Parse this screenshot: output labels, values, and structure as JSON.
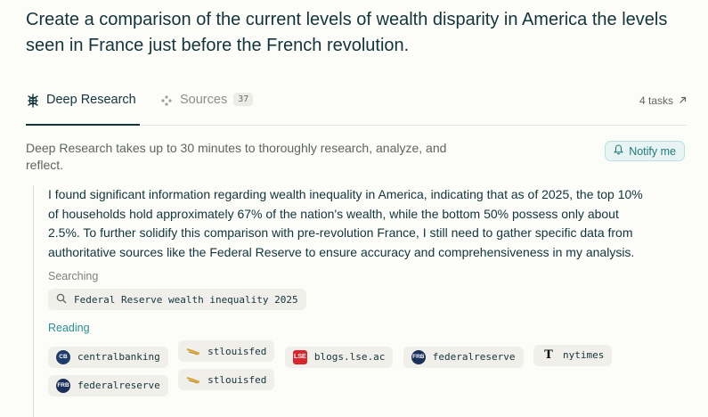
{
  "query": "Create a comparison of the current levels of wealth disparity in America the levels seen in France just before the French revolution.",
  "tabs": {
    "deep_research": "Deep Research",
    "sources": "Sources",
    "sources_count": "37",
    "tasks": "4 tasks"
  },
  "description": "Deep Research takes up to 30 minutes to thoroughly research, analyze, and reflect.",
  "notify_label": "Notify me",
  "panel": {
    "text": "I found significant information regarding wealth inequality in America, indicating that as of 2025, the top 10% of households hold approximately 67% of the nation's wealth, while the bottom 50% possess only about 2.5%. To further solidify this comparison with pre-revolution France, I still need to gather specific data from authoritative sources like the Federal Reserve to ensure accuracy and comprehensiveness in my analysis.",
    "searching_label": "Searching",
    "search_query": "Federal Reserve wealth inequality 2025",
    "reading_label": "Reading",
    "sources_row1": [
      {
        "name": "centralbanking",
        "icon": "centralbanking-icon",
        "badge": "CB"
      },
      {
        "name": "stlouisfed",
        "icon": "stlouisfed-icon",
        "badge": ""
      },
      {
        "name": "blogs.lse.ac",
        "icon": "lse-icon",
        "badge": "LSE"
      },
      {
        "name": "federalreserve",
        "icon": "federalreserve-icon",
        "badge": "FRB"
      },
      {
        "name": "nytimes",
        "icon": "nytimes-icon",
        "badge": "T"
      }
    ],
    "sources_row2": [
      {
        "name": "federalreserve",
        "icon": "federalreserve-icon",
        "badge": "FRB"
      },
      {
        "name": "stlouisfed",
        "icon": "stlouisfed-icon",
        "badge": ""
      }
    ]
  },
  "colors": {
    "accent": "#2a8e93",
    "text": "#13343b",
    "background": "#fcfcf9"
  }
}
